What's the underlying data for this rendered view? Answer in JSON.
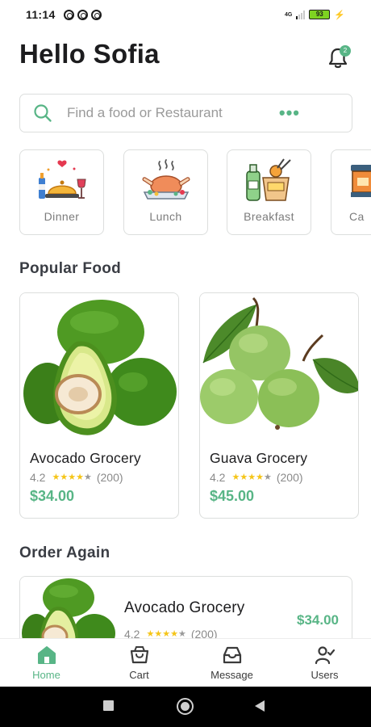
{
  "status_bar": {
    "time": "11:14",
    "network": "4G",
    "battery": "93"
  },
  "header": {
    "greeting": "Hello Sofia",
    "notification_count": "2"
  },
  "search": {
    "placeholder": "Find a food or Restaurant",
    "more_icon": "more-dots-icon"
  },
  "categories": [
    {
      "label": "Dinner",
      "icon": "dinner-icon"
    },
    {
      "label": "Lunch",
      "icon": "lunch-icon"
    },
    {
      "label": "Breakfast",
      "icon": "breakfast-icon"
    },
    {
      "label": "Ca",
      "icon": "cafe-icon"
    }
  ],
  "popular": {
    "title": "Popular Food",
    "items": [
      {
        "name": "Avocado Grocery",
        "rating": "4.2",
        "stars": 4,
        "reviews": "(200)",
        "price": "$34.00"
      },
      {
        "name": "Guava Grocery",
        "rating": "4.2",
        "stars": 4,
        "reviews": "(200)",
        "price": "$45.00"
      }
    ]
  },
  "order_again": {
    "title": "Order Again",
    "items": [
      {
        "name": "Avocado Grocery",
        "rating": "4.2",
        "stars": 4,
        "reviews": "(200)",
        "price": "$34.00"
      }
    ]
  },
  "nav": {
    "items": [
      {
        "label": "Home",
        "icon": "home-icon",
        "active": true
      },
      {
        "label": "Cart",
        "icon": "cart-icon",
        "active": false
      },
      {
        "label": "Message",
        "icon": "message-icon",
        "active": false
      },
      {
        "label": "Users",
        "icon": "users-icon",
        "active": false
      }
    ]
  },
  "colors": {
    "accent": "#58b586",
    "star": "#f5c518",
    "border": "#dcdedd"
  }
}
